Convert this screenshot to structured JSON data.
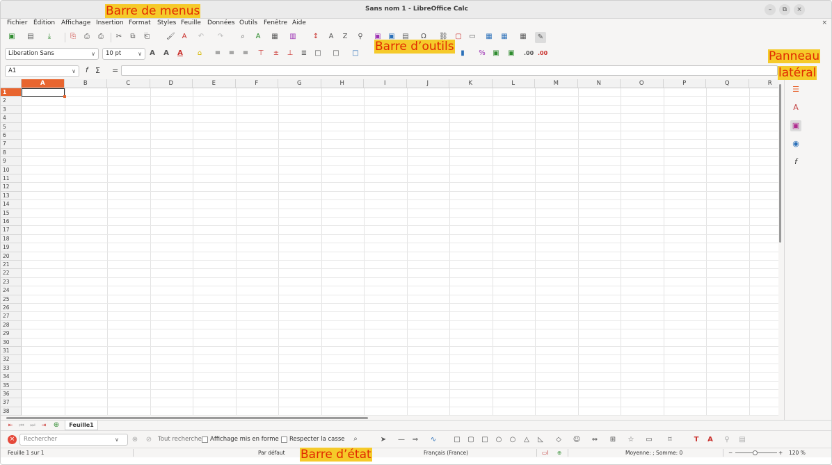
{
  "window": {
    "title": "Sans nom 1 - LibreOffice Calc",
    "minimize_glyph": "–",
    "restore_glyph": "⧉",
    "close_glyph": "×"
  },
  "menubar": {
    "items": [
      "Fichier",
      "Édition",
      "Affichage",
      "Insertion",
      "Format",
      "Styles",
      "Feuille",
      "Données",
      "Outils",
      "Fenêtre",
      "Aide"
    ],
    "doc_close": "×"
  },
  "formatting": {
    "font_name": "Liberation Sans",
    "font_size": "10 pt"
  },
  "formula_bar": {
    "cell_ref": "A1",
    "fx_label": "f",
    "sum_label": "Σ",
    "equals_label": "="
  },
  "columns": [
    "A",
    "B",
    "C",
    "D",
    "E",
    "F",
    "G",
    "H",
    "I",
    "J",
    "K",
    "L",
    "M",
    "N",
    "O",
    "P",
    "Q",
    "R"
  ],
  "row_count": 38,
  "active_cell": {
    "col": "A",
    "row": 1
  },
  "sheet_tabs": [
    {
      "label": "Feuille1",
      "active": true
    }
  ],
  "find_toolbar": {
    "search_placeholder": "Rechercher",
    "find_all_label": "Tout rechercher",
    "formatted_display_label": "Affichage mis en forme",
    "match_case_label": "Respecter la casse"
  },
  "statusbar": {
    "sheet_position": "Feuille 1 sur 1",
    "page_style": "Par défaut",
    "language": "Français (France)",
    "selection_stats": "Moyenne: ; Somme: 0",
    "zoom": "120 %",
    "zoom_minus": "−",
    "zoom_plus": "+"
  },
  "annotations": {
    "menu_bar": "Barre de menus",
    "toolbar": "Barre d’outils",
    "sidebar": [
      "Panneau",
      "latéral"
    ],
    "status_bar": "Barre d’état"
  },
  "colors": {
    "accent": "#e8652f",
    "annotation_bg": "#f5ca2a",
    "annotation_text": "#e12a00"
  }
}
